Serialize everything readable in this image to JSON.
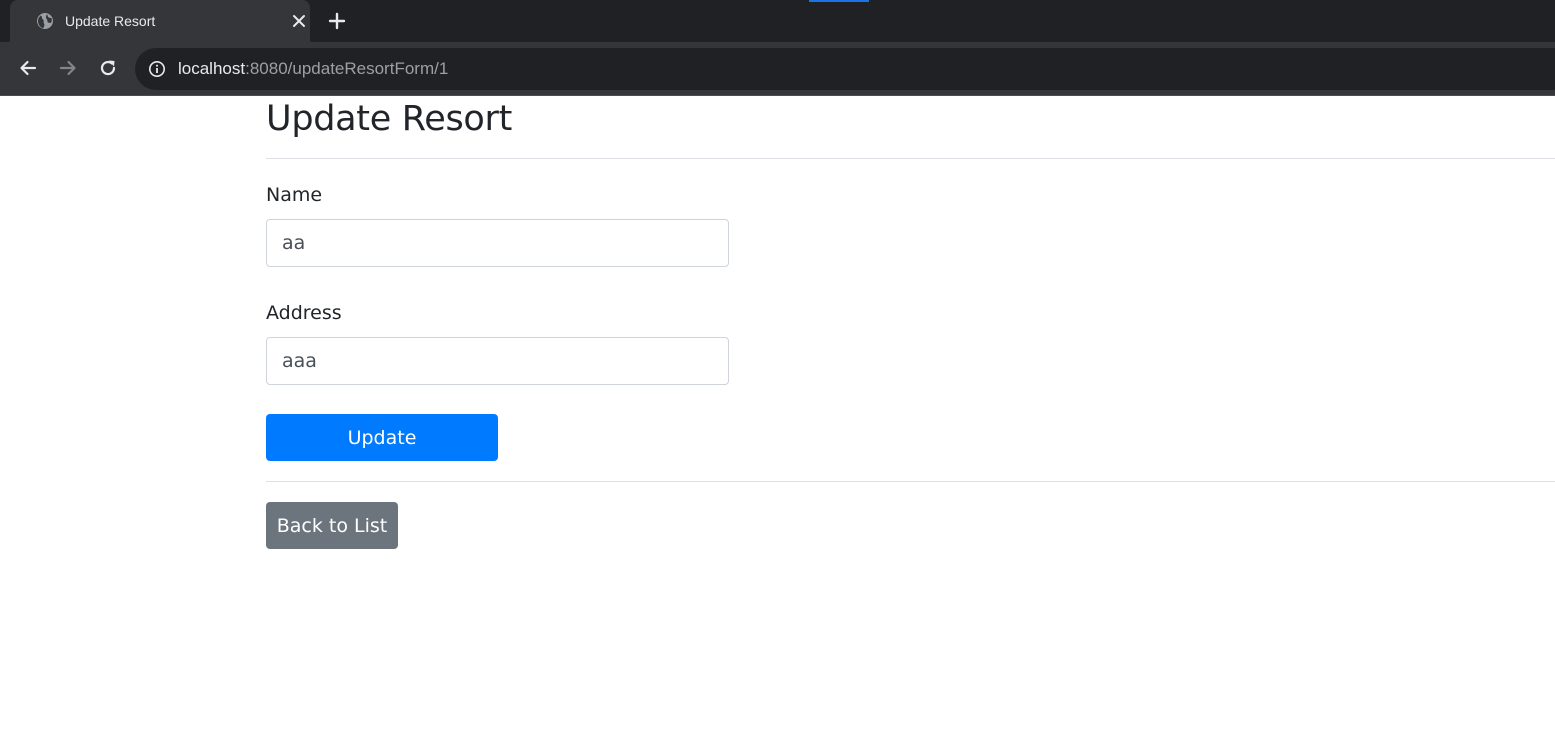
{
  "browser": {
    "tab_title": "Update Resort",
    "url_host": "localhost",
    "url_rest": ":8080/updateResortForm/1"
  },
  "page": {
    "title": "Update Resort",
    "fields": {
      "name": {
        "label": "Name",
        "value": "aa"
      },
      "address": {
        "label": "Address",
        "value": "aaa"
      }
    },
    "buttons": {
      "update": "Update",
      "back": "Back to List"
    }
  },
  "colors": {
    "primary": "#007bff",
    "secondary": "#6c757d",
    "chrome_dark": "#202124",
    "chrome_toolbar": "#35363a"
  },
  "icons": {
    "favicon": "globe-icon",
    "close": "close-icon",
    "new_tab": "plus-icon",
    "back": "arrow-left-icon",
    "forward": "arrow-right-icon",
    "reload": "reload-icon",
    "site_info": "info-icon"
  }
}
